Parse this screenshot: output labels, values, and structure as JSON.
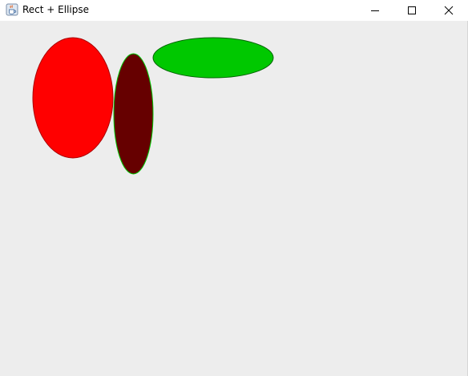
{
  "window": {
    "title": "Rect + Ellipse",
    "app_icon": "java-cup-icon",
    "controls": {
      "minimize_icon": "minimize-icon",
      "maximize_icon": "maximize-icon",
      "close_icon": "close-icon"
    }
  },
  "canvas": {
    "background": "#ededed",
    "shapes": [
      {
        "name": "red-ellipse",
        "fill": "#ff0000",
        "stroke": "#aa0000"
      },
      {
        "name": "dark-red-ellipse",
        "fill": "#660000",
        "stroke": "#00c800"
      },
      {
        "name": "green-ellipse",
        "fill": "#00c800",
        "stroke": "#006400"
      }
    ]
  }
}
